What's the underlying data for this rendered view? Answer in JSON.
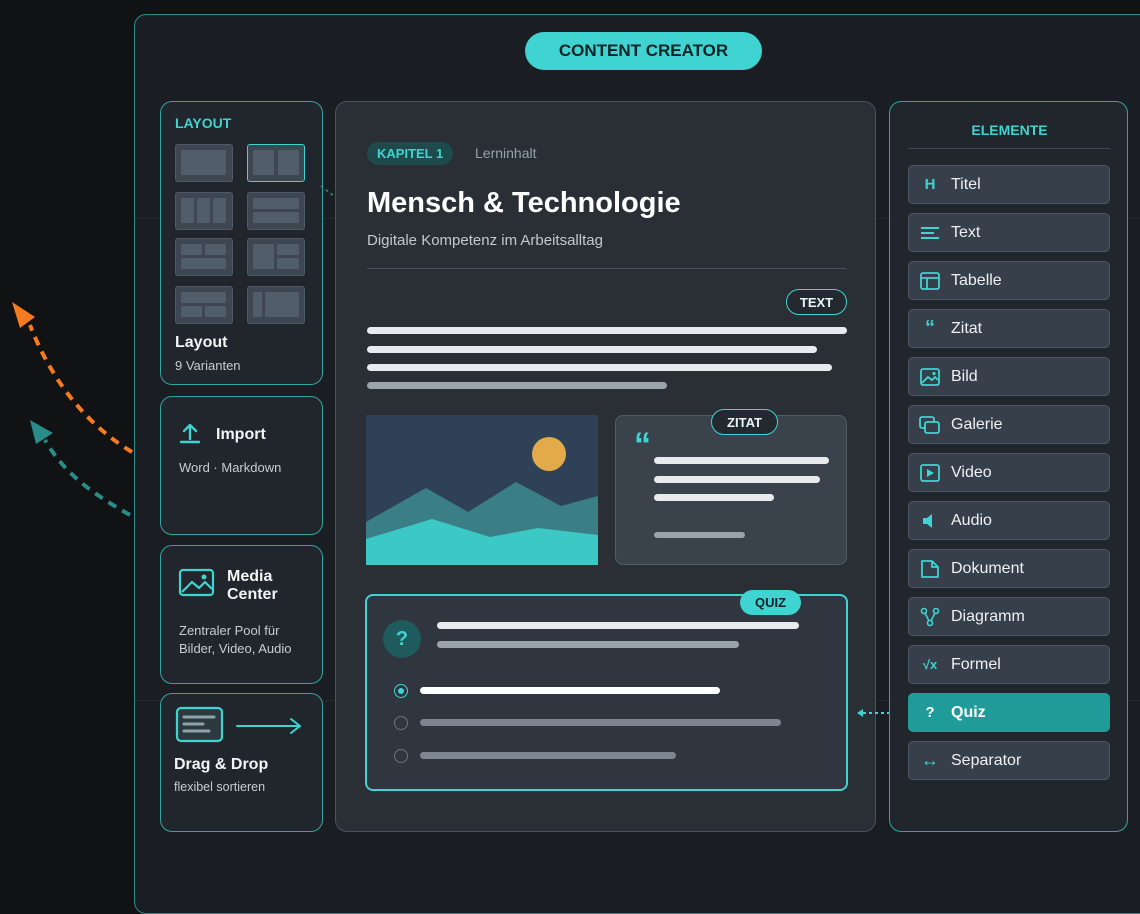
{
  "app": {
    "title": "CONTENT CREATOR"
  },
  "left": {
    "layout": {
      "caption": "LAYOUT",
      "title": "Layout",
      "subtitle": "9 Varianten"
    },
    "import": {
      "title": "Import",
      "subtitle": "Word · Markdown"
    },
    "media": {
      "title_line1": "Media",
      "title_line2": "Center",
      "desc_line1": "Zentraler Pool für",
      "desc_line2": "Bilder, Video, Audio"
    },
    "dragdrop": {
      "title": "Drag & Drop",
      "subtitle": "flexibel sortieren"
    }
  },
  "editor": {
    "badge": "KAPITEL 1",
    "badge_note": "Lerninhalt",
    "heading": "Mensch & Technologie",
    "subheading": "Digitale Kompetenz im Arbeitsalltag",
    "text_tag": "TEXT",
    "quote_tag": "ZITAT",
    "quote_mark": "“",
    "quiz_tag": "QUIZ",
    "quiz_icon": "?"
  },
  "panel": {
    "caption": "ELEMENTE",
    "items": [
      {
        "label": "Titel",
        "icon": "H"
      },
      {
        "label": "Text",
        "icon": "text-lines-icon"
      },
      {
        "label": "Tabelle",
        "icon": "table-icon"
      },
      {
        "label": "Zitat",
        "icon": "“"
      },
      {
        "label": "Bild",
        "icon": "image-icon"
      },
      {
        "label": "Galerie",
        "icon": "gallery-icon"
      },
      {
        "label": "Video",
        "icon": "video-icon"
      },
      {
        "label": "Audio",
        "icon": "audio-icon"
      },
      {
        "label": "Dokument",
        "icon": "document-icon"
      },
      {
        "label": "Diagramm",
        "icon": "diagram-icon"
      },
      {
        "label": "Formel",
        "icon": "√x"
      },
      {
        "label": "Quiz",
        "icon": "?",
        "active": true
      },
      {
        "label": "Separator",
        "icon": "↔"
      }
    ]
  },
  "colors": {
    "accent": "#3fd3d1",
    "accent_dark": "#1f9c99",
    "orange": "#f47b20"
  }
}
